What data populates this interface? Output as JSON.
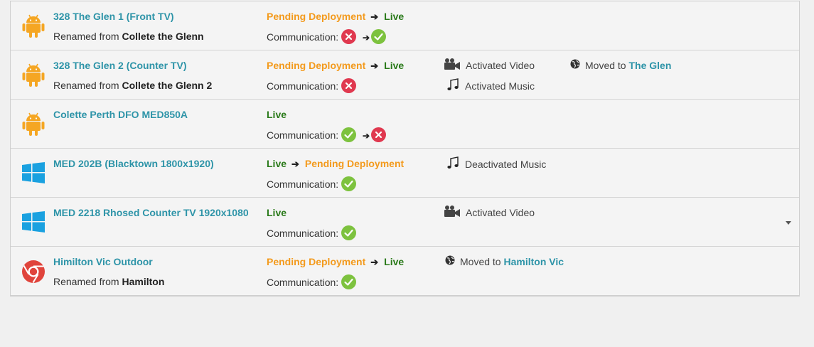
{
  "colors": {
    "link": "#2e94a8",
    "pending": "#f39a1c",
    "live": "#2a7a1a",
    "ok": "#7dc23e",
    "error": "#e0384f",
    "android": "#f5a623",
    "windows": "#1aa1e0",
    "chrome": "#e0443c"
  },
  "devices": [
    {
      "os_icon": "android-icon",
      "name": "328 The Glen 1 (Front TV)",
      "sub_prefix": "Renamed from",
      "sub_value": "Collete the Glenn",
      "status_from": "Pending Deployment",
      "status_to": "Live",
      "comm_label": "Communication:",
      "comm_from": "error",
      "comm_to": "ok",
      "events": []
    },
    {
      "os_icon": "android-icon",
      "name": "328 The Glen 2 (Counter TV)",
      "sub_prefix": "Renamed from",
      "sub_value": "Collete the Glenn 2",
      "status_from": "Pending Deployment",
      "status_to": "Live",
      "comm_label": "Communication:",
      "comm_from": "error",
      "events": [
        {
          "icon": "video-camera-icon",
          "text": "Activated Video"
        },
        {
          "icon": "globe-icon",
          "text": "Moved to",
          "link": "The Glen"
        },
        {
          "icon": "music-note-icon",
          "text": "Activated Music"
        }
      ]
    },
    {
      "os_icon": "android-icon",
      "name": "Colette Perth DFO MED850A",
      "status_from": "Live",
      "comm_label": "Communication:",
      "comm_from": "ok",
      "comm_to": "error",
      "events": []
    },
    {
      "os_icon": "windows-icon",
      "name": "MED 202B (Blacktown 1800x1920)",
      "status_from": "Live",
      "status_to": "Pending Deployment",
      "comm_label": "Communication:",
      "comm_from": "ok",
      "events": [
        {
          "icon": "music-note-icon",
          "text": "Deactivated Music"
        }
      ]
    },
    {
      "os_icon": "windows-icon",
      "name": "MED 2218 Rhosed Counter TV 1920x1080",
      "status_from": "Live",
      "comm_label": "Communication:",
      "comm_from": "ok",
      "events": [
        {
          "icon": "video-camera-icon",
          "text": "Activated Video"
        }
      ]
    },
    {
      "os_icon": "chrome-icon",
      "name": "Himilton Vic Outdoor",
      "sub_prefix": "Renamed from",
      "sub_value": "Hamilton",
      "status_from": "Pending Deployment",
      "status_to": "Live",
      "comm_label": "Communication:",
      "comm_from": "ok",
      "events": [
        {
          "icon": "globe-icon",
          "text": "Moved to",
          "link": "Hamilton Vic"
        }
      ]
    }
  ]
}
